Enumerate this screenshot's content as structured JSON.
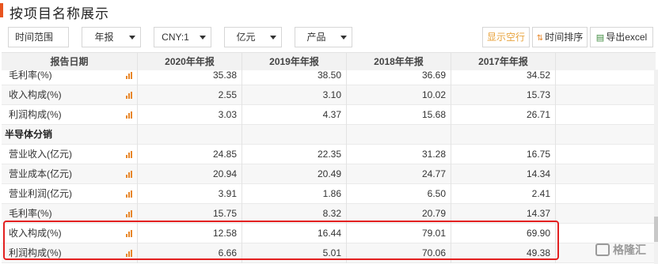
{
  "title": "按项目名称展示",
  "toolbar": {
    "time_range": "时间范围",
    "period": "年报",
    "currency": "CNY:1",
    "unit": "亿元",
    "category": "产品",
    "show_empty": "显示空行",
    "sort_time": "时间排序",
    "export": "导出excel"
  },
  "table": {
    "headers": [
      "报告日期",
      "2020年年报",
      "2019年年报",
      "2018年年报",
      "2017年年报"
    ],
    "rows": [
      {
        "name": "毛利率(%)",
        "values": [
          "35.38",
          "38.50",
          "36.69",
          "34.52"
        ],
        "chart": true
      },
      {
        "name": "收入构成(%)",
        "values": [
          "2.55",
          "3.10",
          "10.02",
          "15.73"
        ],
        "chart": true
      },
      {
        "name": "利润构成(%)",
        "values": [
          "3.03",
          "4.37",
          "15.68",
          "26.71"
        ],
        "chart": true
      },
      {
        "name": "半导体分销",
        "values": [
          "",
          "",
          "",
          ""
        ],
        "chart": false,
        "section": true
      },
      {
        "name": "营业收入(亿元)",
        "values": [
          "24.85",
          "22.35",
          "31.28",
          "16.75"
        ],
        "chart": true
      },
      {
        "name": "营业成本(亿元)",
        "values": [
          "20.94",
          "20.49",
          "24.77",
          "14.34"
        ],
        "chart": true
      },
      {
        "name": "营业利润(亿元)",
        "values": [
          "3.91",
          "1.86",
          "6.50",
          "2.41"
        ],
        "chart": true
      },
      {
        "name": "毛利率(%)",
        "values": [
          "15.75",
          "8.32",
          "20.79",
          "14.37"
        ],
        "chart": true
      },
      {
        "name": "收入构成(%)",
        "values": [
          "12.58",
          "16.44",
          "79.01",
          "69.90"
        ],
        "chart": true
      },
      {
        "name": "利润构成(%)",
        "values": [
          "6.66",
          "5.01",
          "70.06",
          "49.38"
        ],
        "chart": true
      }
    ]
  },
  "watermark": "格隆汇",
  "colors": {
    "accent": "#e8541e",
    "highlight": "#e32020",
    "chart_icon": "#e8872a"
  }
}
